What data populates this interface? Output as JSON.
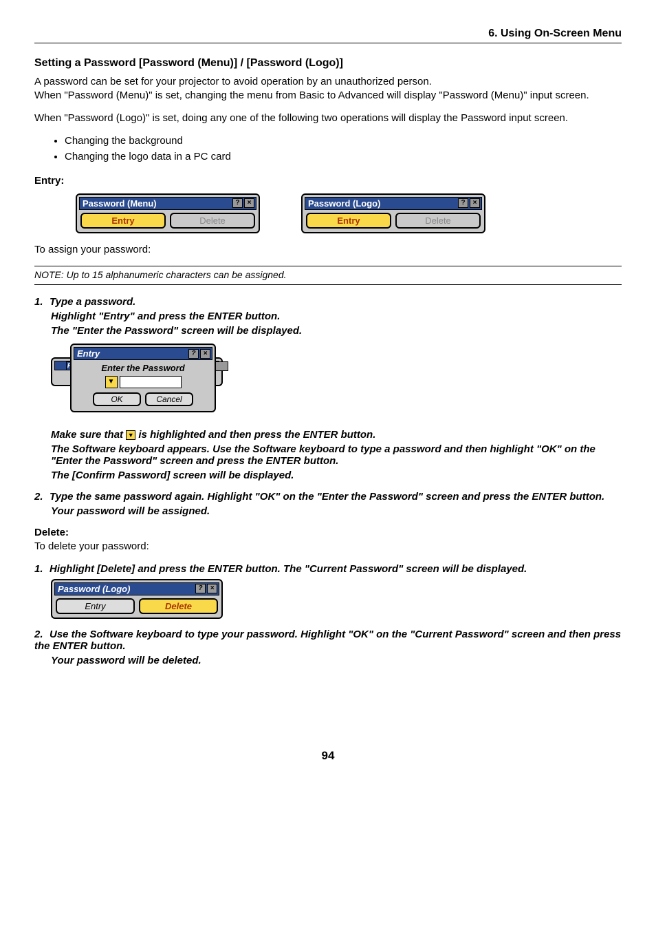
{
  "header": {
    "section": "6. Using On-Screen Menu"
  },
  "title": "Setting a Password [Password (Menu)] / [Password (Logo)]",
  "intro": {
    "p1": "A password can be set for your projector to avoid operation by an unauthorized person.",
    "p2": "When \"Password (Menu)\" is set, changing the menu from Basic to Advanced will display \"Password (Menu)\" input screen.",
    "p3": "When \"Password (Logo)\" is set, doing any one of the following two operations will display the Password input screen."
  },
  "bullets": [
    "Changing the background",
    "Changing the logo data in a PC card"
  ],
  "entry": {
    "label": "Entry:",
    "dialogs": {
      "menu": {
        "title": "Password (Menu)",
        "entry": "Entry",
        "delete": "Delete"
      },
      "logo": {
        "title": "Password (Logo)",
        "entry": "Entry",
        "delete": "Delete"
      }
    },
    "assign": "To assign your password:",
    "note": "NOTE: Up to 15 alphanumeric characters can be assigned."
  },
  "step1": {
    "num": "1.",
    "title": "Type a password.",
    "line1": "Highlight \"Entry\" and press the ENTER button.",
    "line2": "The \"Enter the Password\" screen will be displayed.",
    "screenshot": {
      "title": "Entry",
      "label": "Enter the Password",
      "ok": "OK",
      "cancel": "Cancel",
      "bg_hint": "Pa"
    },
    "line3a": "Make sure that ",
    "line3b": " is highlighted and then press the ENTER button.",
    "line4": "The Software keyboard appears. Use the Software keyboard to type a password and then highlight \"OK\" on the \"Enter the Password\" screen and press the ENTER button.",
    "line5": "The [Confirm Password] screen will be displayed."
  },
  "step2": {
    "num": "2.",
    "title": "Type the same password again. Highlight \"OK\" on the \"Enter the Password\" screen and press the ENTER button.",
    "line1": "Your password will be assigned."
  },
  "delete": {
    "label": "Delete:",
    "intro": "To delete your password:",
    "step1_num": "1.",
    "step1": "Highlight [Delete] and press the ENTER button. The \"Current Password\" screen will be displayed.",
    "dialog": {
      "title": "Password (Logo)",
      "entry": "Entry",
      "delete": "Delete"
    },
    "step2_num": "2.",
    "step2": "Use the Software keyboard to type your password. Highlight \"OK\" on the \"Current Password\" screen and then press the ENTER button.",
    "step2b": "Your password will be deleted."
  },
  "pagenum": "94"
}
